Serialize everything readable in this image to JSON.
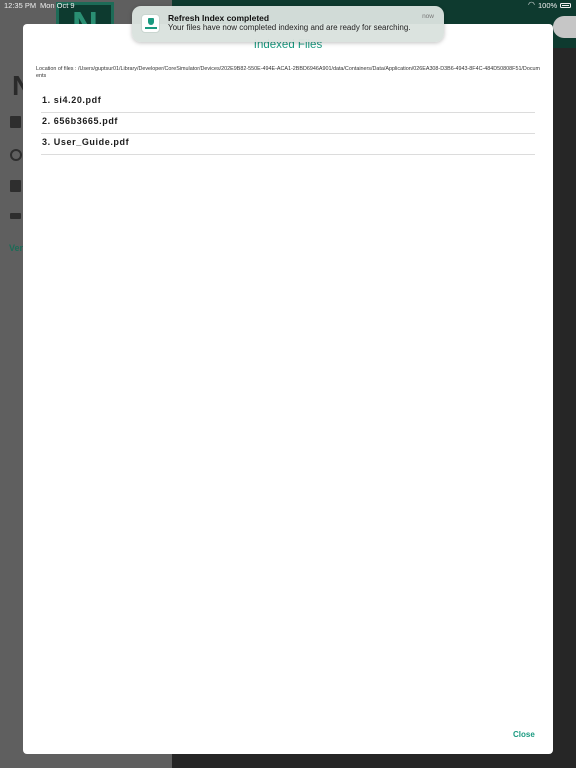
{
  "status_bar": {
    "time": "12:35 PM",
    "date": "Mon Oct 9",
    "battery": "100%"
  },
  "notification": {
    "title": "Refresh Index completed",
    "body": "Your files have now completed indexing and are ready for searching.",
    "time": "now"
  },
  "background": {
    "logo_letter": "N",
    "sidebar_letter": "N",
    "version_label": "Ver"
  },
  "modal": {
    "title": "Indexed Files",
    "location_text": "Location of files : /Users/guptsur01/Library/Developer/CoreSimulator/Devices/202E9B82-550E-494E-ACA1-2BBD6946A901/data/Containers/Data/Application/026EA308-D3B6-4943-8F4C-484D50808F51/Documents",
    "files": [
      "1. si4.20.pdf",
      "2. 656b3665.pdf",
      "3. User_Guide.pdf"
    ],
    "close_label": "Close"
  },
  "colors": {
    "accent": "#1a9a80",
    "header_bg": "#0e3a2f"
  }
}
